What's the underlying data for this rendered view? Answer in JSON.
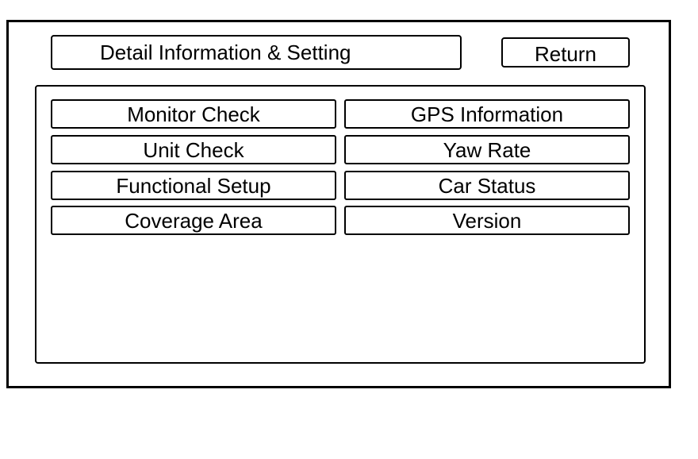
{
  "header": {
    "title": "Detail Information & Setting",
    "return_label": "Return"
  },
  "menu": {
    "left": [
      {
        "label": "Monitor Check"
      },
      {
        "label": "Unit Check"
      },
      {
        "label": "Functional Setup"
      },
      {
        "label": "Coverage Area"
      }
    ],
    "right": [
      {
        "label": "GPS Information"
      },
      {
        "label": "Yaw Rate"
      },
      {
        "label": "Car Status"
      },
      {
        "label": "Version"
      }
    ]
  }
}
